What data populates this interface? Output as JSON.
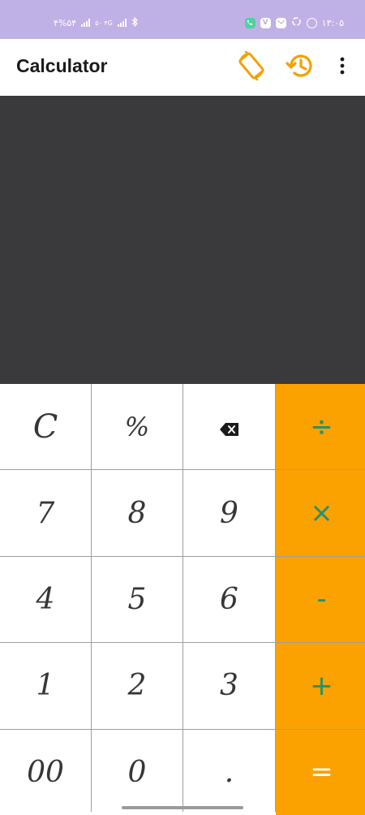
{
  "status_bar": {
    "battery": "۴%۵۴",
    "network": "۵۰ ۴G",
    "time": "۱۳:۰۵"
  },
  "app_bar": {
    "title": "Calculator"
  },
  "colors": {
    "status_bar_bg": "#bfb1e6",
    "display_bg": "#3a393b",
    "operator_bg": "#fba100",
    "operator_fg": "#1e9377",
    "icon_accent": "#f5a000"
  },
  "display": {
    "value": ""
  },
  "keypad": {
    "clear": "C",
    "percent": "%",
    "backspace": "",
    "divide": "÷",
    "seven": "7",
    "eight": "8",
    "nine": "9",
    "multiply": "×",
    "four": "4",
    "five": "5",
    "six": "6",
    "minus": "-",
    "one": "1",
    "two": "2",
    "three": "3",
    "plus": "+",
    "double_zero": "00",
    "zero": "0",
    "decimal": ".",
    "equals": "="
  }
}
